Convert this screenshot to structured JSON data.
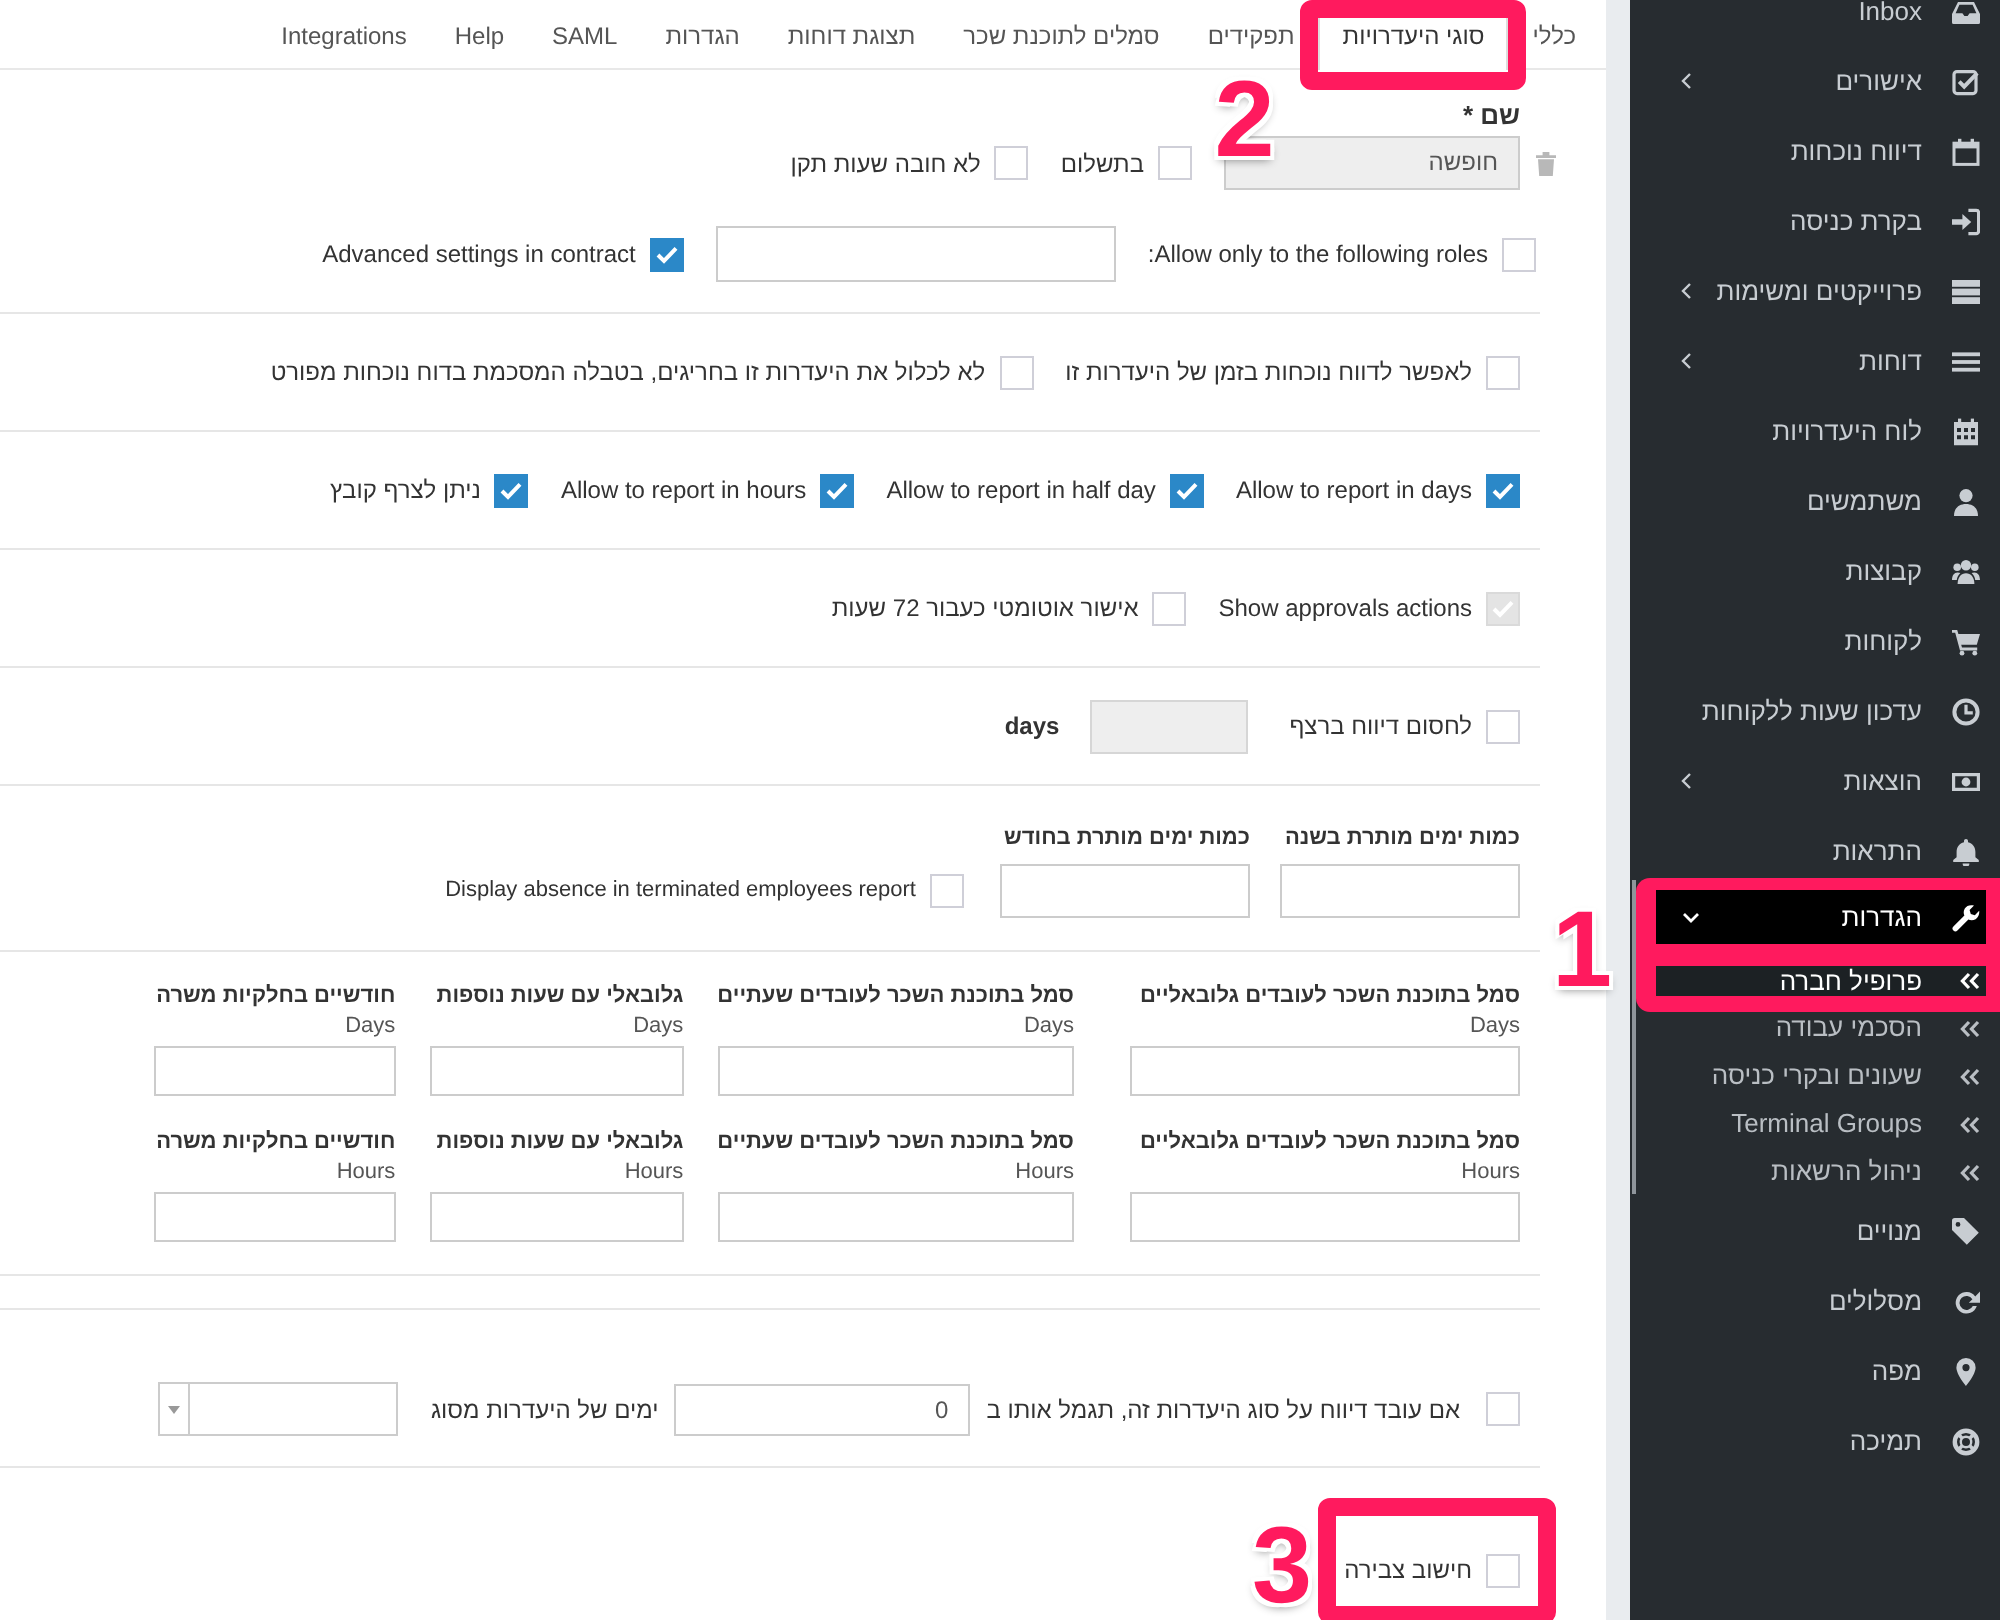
{
  "tabs": [
    {
      "label": "כללי",
      "selected": false
    },
    {
      "label": "סוגי היעדרויות",
      "selected": true,
      "callout": "2"
    },
    {
      "label": "תפקידים",
      "selected": false
    },
    {
      "label": "סמלים לתוכנת שכר",
      "selected": false
    },
    {
      "label": "תצוגת דוחות",
      "selected": false
    },
    {
      "label": "הגדרות",
      "selected": false
    },
    {
      "label": "SAML",
      "selected": false
    },
    {
      "label": "Help",
      "selected": false
    },
    {
      "label": "Integrations",
      "selected": false
    }
  ],
  "form": {
    "name": {
      "label": "שם *",
      "value": "חופשה",
      "disabled": true
    },
    "name_options": [
      {
        "label": "בתשלום",
        "checked": false
      },
      {
        "label": "לא חובה שעות תקן",
        "checked": false
      }
    ],
    "roles": {
      "label": "Allow only to the following roles:",
      "checked": false
    },
    "advanced_settings": {
      "label": "Advanced settings in contract",
      "checked": true
    },
    "attendance_options": [
      {
        "label": "לאפשר לדווח נוכחות בזמן של היעדרות זו",
        "checked": false
      },
      {
        "label": "לא לכלול את היעדרות זו בחריגים, בטבלה המסכמת בדוח נוכחות מפורט",
        "checked": false
      }
    ],
    "report_options": [
      {
        "label": "Allow to report in days",
        "checked": true
      },
      {
        "label": "Allow to report in half day",
        "checked": true
      },
      {
        "label": "Allow to report in hours",
        "checked": true
      },
      {
        "label": "ניתן לצרף קובץ",
        "checked": true
      }
    ],
    "approval_options": [
      {
        "label": "Show approvals actions",
        "checked": true,
        "disabled": true
      },
      {
        "label": "אישור אוטומטי כעבור 72 שעות",
        "checked": false,
        "disabled": false
      }
    ],
    "block_consecutive": {
      "label": "לחסום דיווח ברצף",
      "checked": false,
      "unit": "days"
    },
    "quotas": [
      {
        "label": "כמות ימים מותרת בשנה"
      },
      {
        "label": "כמות ימים מותרת בחודש"
      }
    ],
    "terminated_report": {
      "label": "Display absence in terminated employees report",
      "checked": false
    },
    "payroll_codes": [
      {
        "label": "סמל בתוכנת השכר לעובדים גלובאליים",
        "unit": "Days"
      },
      {
        "label": "סמל בתוכנת השכר לעובדים שעתיים",
        "unit": "Days"
      },
      {
        "label": "גלובאלי עם שעות נוספות",
        "unit": "Days"
      },
      {
        "label": "חודשיים בחלקיות משרה",
        "unit": "Days"
      },
      {
        "label": "סמל בתוכנת השכר לעובדים גלובאליים",
        "unit": "Hours"
      },
      {
        "label": "סמל בתוכנת השכר לעובדים שעתיים",
        "unit": "Hours"
      },
      {
        "label": "גלובאלי עם שעות נוספות",
        "unit": "Hours"
      },
      {
        "label": "חודשיים בחלקיות משרה",
        "unit": "Hours"
      }
    ],
    "reward": {
      "label": "אם עובד דיווח על סוג היעדרות זה, תגמל אותו ב",
      "checked": false,
      "value": "0",
      "suffix": "ימים של היעדרות מסוג"
    },
    "accrual": {
      "label": "חישוב צבירה",
      "checked": false,
      "callout": "3"
    }
  },
  "sidebar": {
    "items": [
      {
        "label": "Inbox",
        "submenu": false,
        "expanded": false
      },
      {
        "label": "אישורים",
        "submenu": true,
        "expanded": false
      },
      {
        "label": "דיווח נוכחות",
        "submenu": false,
        "expanded": false
      },
      {
        "label": "בקרת כניסה",
        "submenu": false,
        "expanded": false
      },
      {
        "label": "פרוייקטים ומשימות",
        "submenu": true,
        "expanded": false
      },
      {
        "label": "דוחות",
        "submenu": true,
        "expanded": false
      },
      {
        "label": "לוח היעדרויות",
        "submenu": false,
        "expanded": false
      },
      {
        "label": "משתמשים",
        "submenu": false,
        "expanded": false
      },
      {
        "label": "קבוצות",
        "submenu": false,
        "expanded": false
      },
      {
        "label": "לקוחות",
        "submenu": false,
        "expanded": false
      },
      {
        "label": "עדכון שעות ללקוחות",
        "submenu": false,
        "expanded": false
      },
      {
        "label": "הוצאות",
        "submenu": true,
        "expanded": false
      },
      {
        "label": "התראות",
        "submenu": false,
        "expanded": false
      },
      {
        "label": "הגדרות",
        "submenu": true,
        "expanded": true,
        "callout": "1",
        "children": [
          {
            "label": "פרופיל חברה",
            "selected": true
          },
          {
            "label": "הסכמי עבודה",
            "selected": false
          },
          {
            "label": "שעונים ובקרי כניסה",
            "selected": false
          },
          {
            "label": "Terminal Groups",
            "selected": false
          },
          {
            "label": "ניהול הרשאות",
            "selected": false
          }
        ]
      },
      {
        "label": "מנויים",
        "submenu": false,
        "expanded": false
      },
      {
        "label": "מסלולים",
        "submenu": false,
        "expanded": false
      },
      {
        "label": "מפה",
        "submenu": false,
        "expanded": false
      },
      {
        "label": "תמיכה",
        "submenu": false,
        "expanded": false
      }
    ]
  }
}
